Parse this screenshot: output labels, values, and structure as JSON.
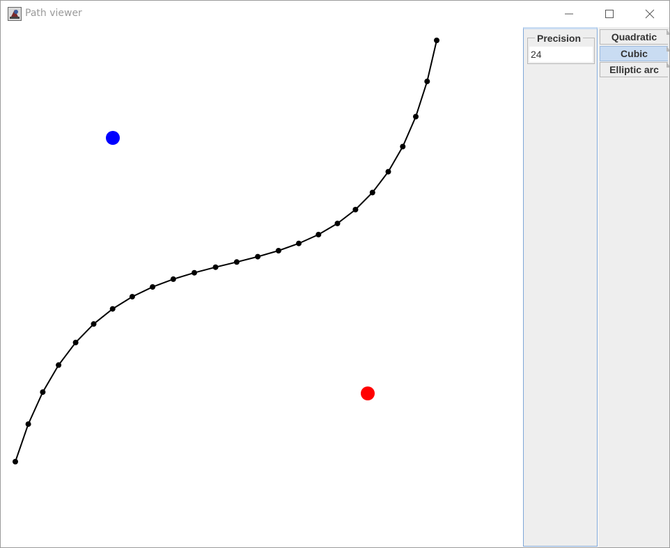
{
  "window": {
    "title": "Path viewer",
    "minimize_icon": "minimize-icon",
    "maximize_icon": "maximize-icon",
    "close_icon": "close-icon",
    "app_icon": "java-app-icon"
  },
  "canvas": {
    "curve_color": "#000000",
    "control_point_colors": [
      "#0000ff",
      "#ff0000"
    ]
  },
  "side_panel": {
    "precision_label": "Precision",
    "precision_value": "24"
  },
  "tabs": [
    {
      "label": "Quadratic",
      "selected": false
    },
    {
      "label": "Cubic",
      "selected": true
    },
    {
      "label": "Elliptic arc",
      "selected": false
    }
  ]
}
